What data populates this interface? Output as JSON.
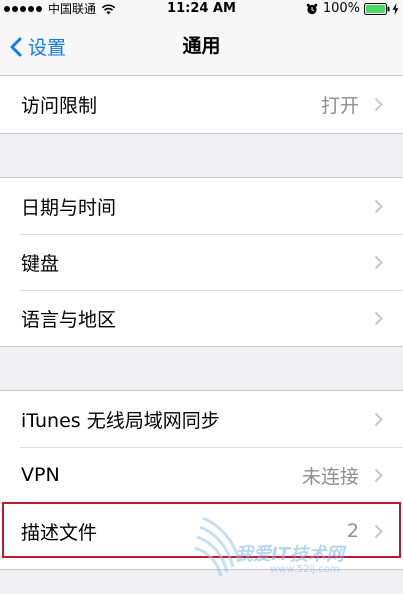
{
  "status_bar": {
    "carrier": "中国联通",
    "time": "11:24 AM",
    "battery_percent": "100%",
    "signal_bars": 5,
    "battery_level": 1.0
  },
  "nav": {
    "back_label": "设置",
    "title": "通用"
  },
  "groups": {
    "top": [
      {
        "label": "访问限制",
        "detail": "打开"
      }
    ],
    "middle": [
      {
        "label": "日期与时间",
        "detail": ""
      },
      {
        "label": "键盘",
        "detail": ""
      },
      {
        "label": "语言与地区",
        "detail": ""
      }
    ],
    "bottom": [
      {
        "label": "iTunes 无线局域网同步",
        "detail": ""
      },
      {
        "label": "VPN",
        "detail": "未连接"
      },
      {
        "label": "描述文件",
        "detail": "2"
      }
    ]
  },
  "watermark": {
    "text": "我爱IT技术网",
    "url": "www.52ij.com"
  },
  "colors": {
    "accent": "#0a7aff",
    "highlight": "#c4182e",
    "battery": "#4cd964"
  },
  "icons": [
    "wifi-icon",
    "alarm-icon",
    "battery-icon",
    "charging-icon",
    "chevron-left-icon",
    "chevron-right-icon"
  ]
}
